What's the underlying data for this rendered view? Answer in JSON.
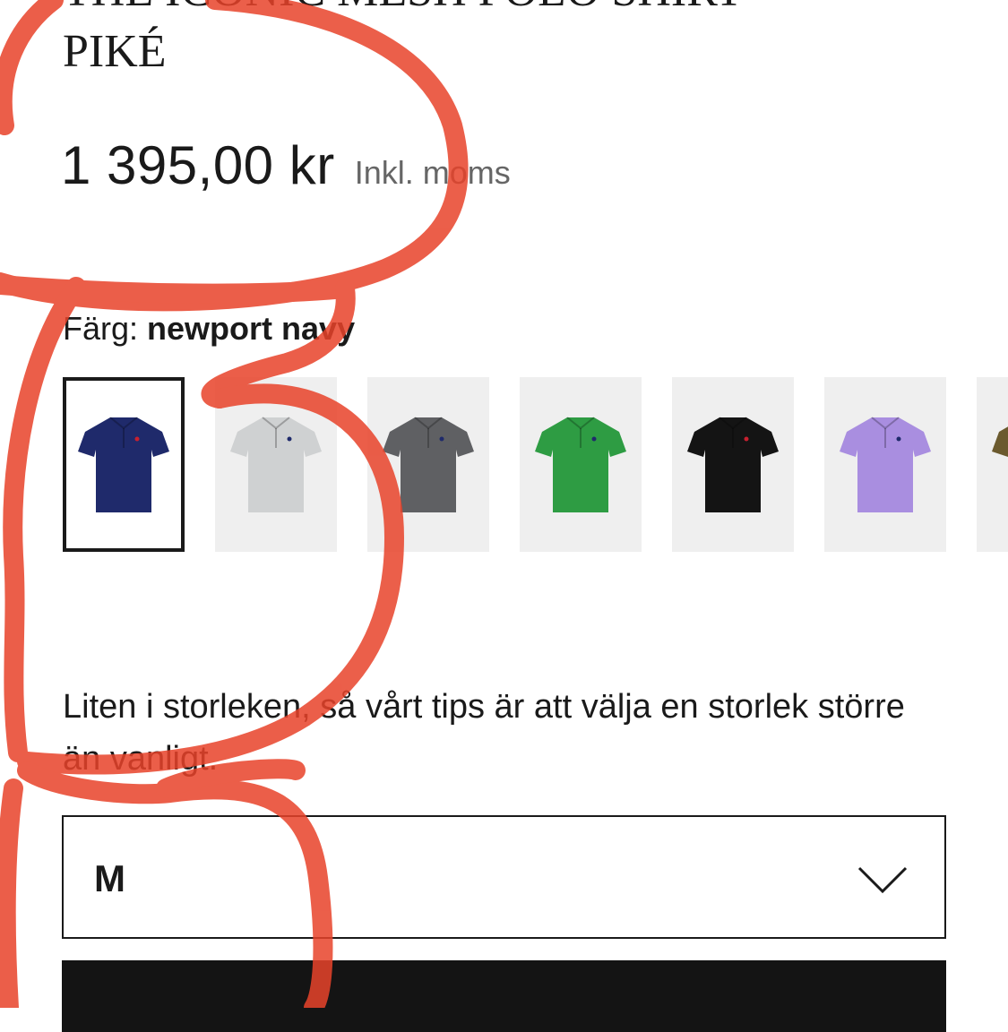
{
  "product": {
    "title_line1": "THE ICONIC MESH POLO SHIRT -",
    "title_line2": "PIKÉ",
    "price": "1 395,00 kr",
    "vat_note": "Inkl. moms"
  },
  "color": {
    "label": "Färg:",
    "selected_name": "newport navy",
    "swatches": [
      {
        "shirt_color": "#1f2a6b",
        "logo_color": "#c8202f",
        "selected": true
      },
      {
        "shirt_color": "#cfd1d2",
        "logo_color": "#1f2a6b",
        "selected": false
      },
      {
        "shirt_color": "#5f6063",
        "logo_color": "#1f2a6b",
        "selected": false
      },
      {
        "shirt_color": "#2e9c43",
        "logo_color": "#1f2a6b",
        "selected": false
      },
      {
        "shirt_color": "#141414",
        "logo_color": "#c8202f",
        "selected": false
      },
      {
        "shirt_color": "#a98ee0",
        "logo_color": "#1f2a6b",
        "selected": false
      },
      {
        "shirt_color": "#6b5a2e",
        "logo_color": "#1f2a6b",
        "selected": false
      }
    ]
  },
  "fit_tip": "Liten i storleken, så vårt tips är att välja en storlek större än vanligt.",
  "size": {
    "selected": "M",
    "icon": "chevron-down-icon"
  },
  "annotation_color": "#e8432a"
}
